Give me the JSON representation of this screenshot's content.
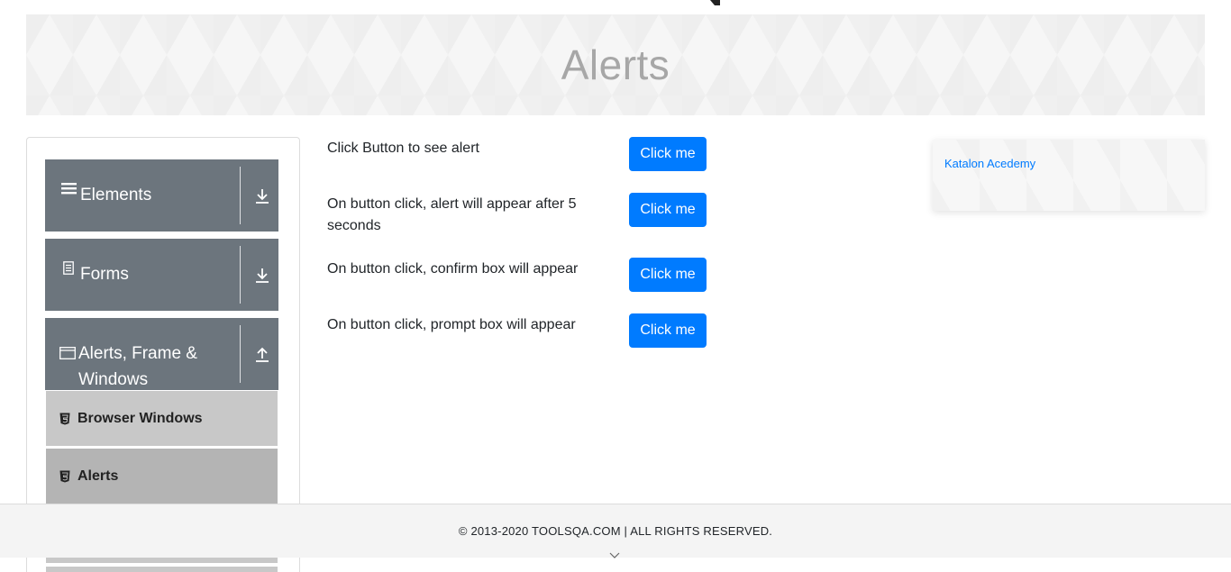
{
  "page_title": "Alerts",
  "sidebar": {
    "groups": [
      {
        "label": "Elements",
        "icon": "menu-icon",
        "arrow": "download-arrow-icon"
      },
      {
        "label": "Forms",
        "icon": "document-icon",
        "arrow": "download-arrow-icon"
      },
      {
        "label": "Alerts, Frame & Windows",
        "icon": "window-icon",
        "arrow": "upload-arrow-icon"
      }
    ],
    "items": [
      {
        "label": "Browser Windows",
        "icon": "html5-icon"
      },
      {
        "label": "Alerts",
        "icon": "html5-icon"
      }
    ]
  },
  "alerts": [
    {
      "text": "Click Button to see alert",
      "button": "Click me"
    },
    {
      "text": "On button click, alert will appear after 5 seconds",
      "button": "Click me"
    },
    {
      "text": "On button click, confirm box will appear",
      "button": "Click me"
    },
    {
      "text": "On button click, prompt box will appear",
      "button": "Click me"
    }
  ],
  "ad": {
    "link": "Katalon Acedemy"
  },
  "footer": {
    "copyright": "© 2013-2020 TOOLSQA.COM | ALL RIGHTS RESERVED."
  },
  "colors": {
    "primary": "#007bff",
    "sidebar_group": "#6c757d",
    "sidebar_item": "#c8c8c8",
    "sidebar_item_active": "#b4b4b4"
  }
}
